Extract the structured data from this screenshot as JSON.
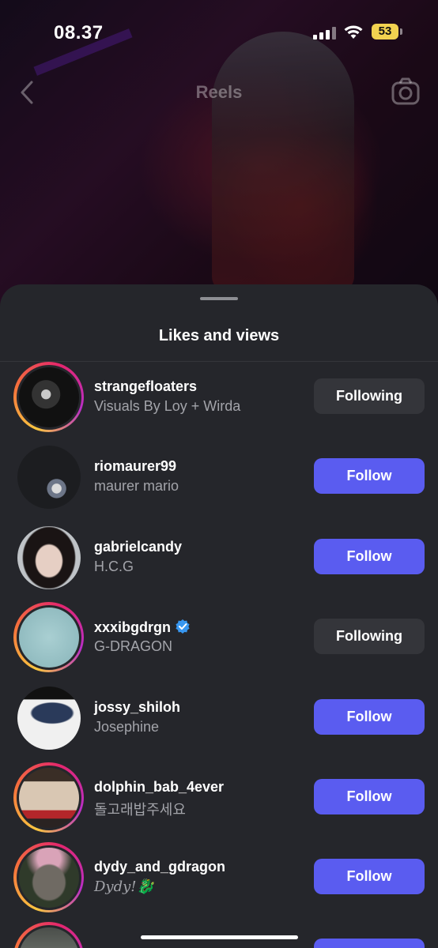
{
  "status_bar": {
    "time": "08.37",
    "battery": "53"
  },
  "header": {
    "title": "Reels",
    "back_icon": "chevron-left-icon",
    "camera_icon": "camera-icon"
  },
  "sheet": {
    "title": "Likes and views",
    "users": [
      {
        "username": "strangefloaters",
        "name": "Visuals By Loy + Wirda",
        "button": "Following",
        "state": "following",
        "story_ring": true,
        "verified": false
      },
      {
        "username": "riomaurer99",
        "name": "maurer mario",
        "button": "Follow",
        "state": "follow",
        "story_ring": false,
        "verified": false
      },
      {
        "username": "gabrielcandy",
        "name": "H.C.G",
        "button": "Follow",
        "state": "follow",
        "story_ring": false,
        "verified": false
      },
      {
        "username": "xxxibgdrgn",
        "name": "G-DRAGON",
        "button": "Following",
        "state": "following",
        "story_ring": true,
        "verified": true
      },
      {
        "username": "jossy_shiloh",
        "name": "Josephine",
        "button": "Follow",
        "state": "follow",
        "story_ring": false,
        "verified": false
      },
      {
        "username": "dolphin_bab_4ever",
        "name": "돌고래밥주세요",
        "button": "Follow",
        "state": "follow",
        "story_ring": true,
        "verified": false
      },
      {
        "username": "dydy_and_gdragon",
        "name": "Dydy!🐉",
        "button": "Follow",
        "state": "follow",
        "story_ring": true,
        "verified": false
      }
    ]
  },
  "colors": {
    "follow_button": "#5a5cf0",
    "following_button": "#34353a",
    "sheet_bg": "#25262b",
    "secondary_text": "#a3a4aa"
  }
}
